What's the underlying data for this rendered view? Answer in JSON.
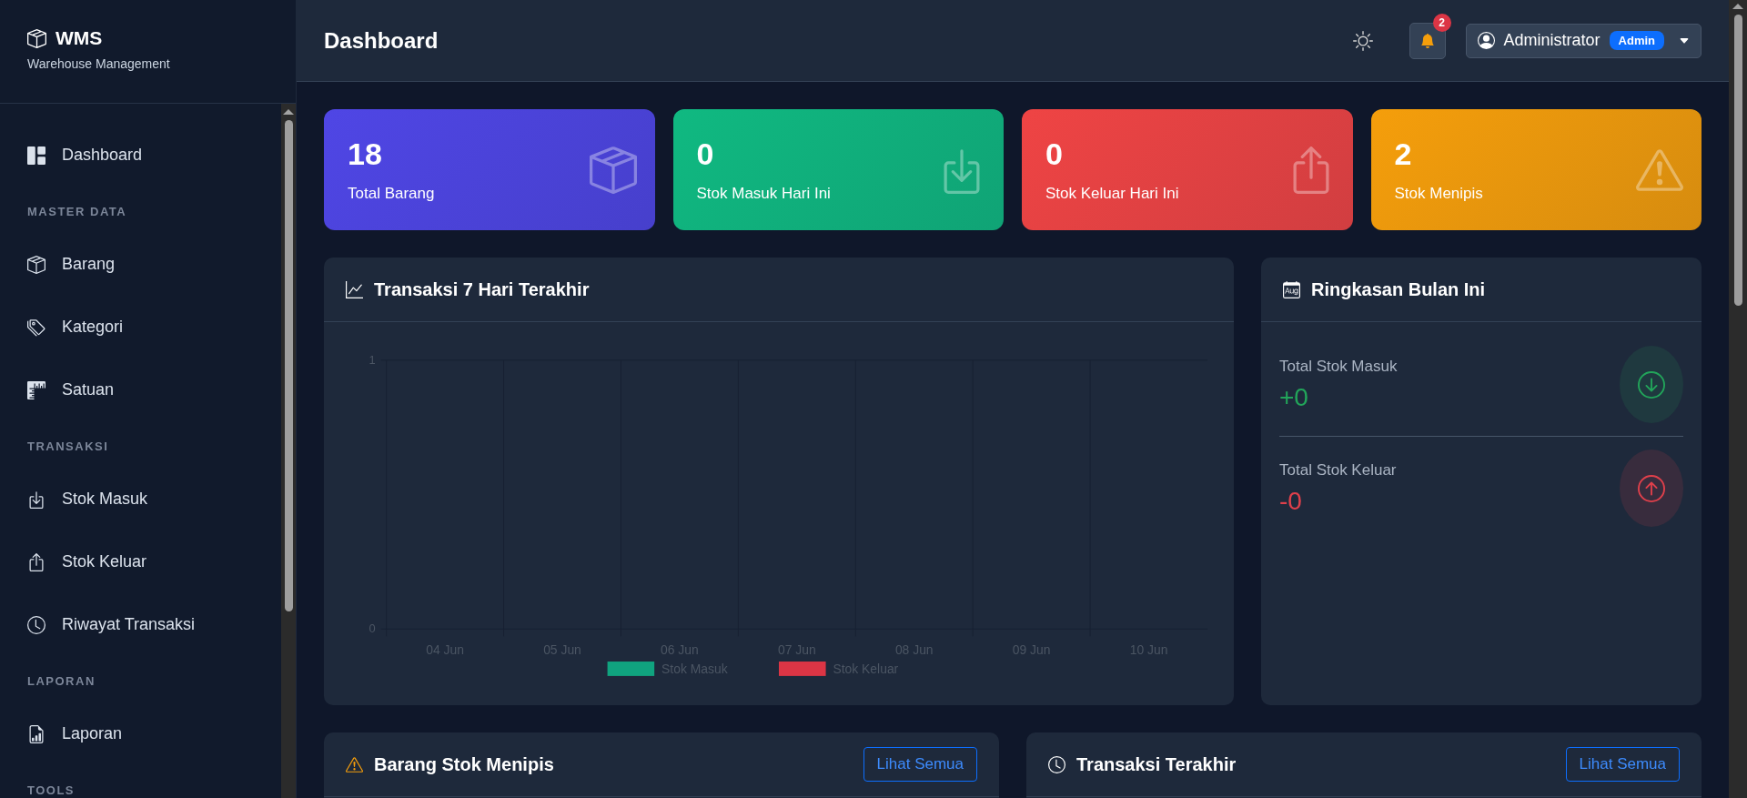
{
  "brand": {
    "name": "WMS",
    "subtitle": "Warehouse Management"
  },
  "sidebar": {
    "items": [
      {
        "kind": "item",
        "label": "Dashboard"
      },
      {
        "kind": "section",
        "label": "MASTER DATA"
      },
      {
        "kind": "item",
        "label": "Barang"
      },
      {
        "kind": "item",
        "label": "Kategori"
      },
      {
        "kind": "item",
        "label": "Satuan"
      },
      {
        "kind": "section",
        "label": "TRANSAKSI"
      },
      {
        "kind": "item",
        "label": "Stok Masuk"
      },
      {
        "kind": "item",
        "label": "Stok Keluar"
      },
      {
        "kind": "item",
        "label": "Riwayat Transaksi"
      },
      {
        "kind": "section",
        "label": "LAPORAN"
      },
      {
        "kind": "item",
        "label": "Laporan"
      },
      {
        "kind": "section",
        "label": "TOOLS"
      }
    ]
  },
  "header": {
    "title": "Dashboard",
    "notification_count": "2",
    "user": {
      "name": "Administrator",
      "role": "Admin"
    }
  },
  "stats": [
    {
      "value": "18",
      "label": "Total Barang",
      "color": "#4f46e5"
    },
    {
      "value": "0",
      "label": "Stok Masuk Hari Ini",
      "color": "#10b981"
    },
    {
      "value": "0",
      "label": "Stok Keluar Hari Ini",
      "color": "#ef4444"
    },
    {
      "value": "2",
      "label": "Stok Menipis",
      "color": "#f59e0b"
    }
  ],
  "chart_panel": {
    "title": "Transaksi 7 Hari Terakhir",
    "chart_data": {
      "type": "bar",
      "categories": [
        "04 Jun",
        "05 Jun",
        "06 Jun",
        "07 Jun",
        "08 Jun",
        "09 Jun",
        "10 Jun"
      ],
      "ylim": [
        0,
        1
      ],
      "yticks": [
        0,
        1
      ],
      "series": [
        {
          "name": "Stok Masuk",
          "color": "#10a37f",
          "values": [
            0,
            0,
            0,
            0,
            0,
            0,
            0
          ]
        },
        {
          "name": "Stok Keluar",
          "color": "#dc3545",
          "values": [
            0,
            0,
            0,
            0,
            0,
            0,
            0
          ]
        }
      ]
    }
  },
  "summary_panel": {
    "title": "Ringkasan Bulan Ini",
    "items": [
      {
        "label": "Total Stok Masuk",
        "value": "+0",
        "color": "#22a55a"
      },
      {
        "label": "Total Stok Keluar",
        "value": "-0",
        "color": "#e0404b"
      }
    ]
  },
  "bottom_panels": [
    {
      "title": "Barang Stok Menipis",
      "button": "Lihat Semua"
    },
    {
      "title": "Transaksi Terakhir",
      "button": "Lihat Semua"
    }
  ]
}
